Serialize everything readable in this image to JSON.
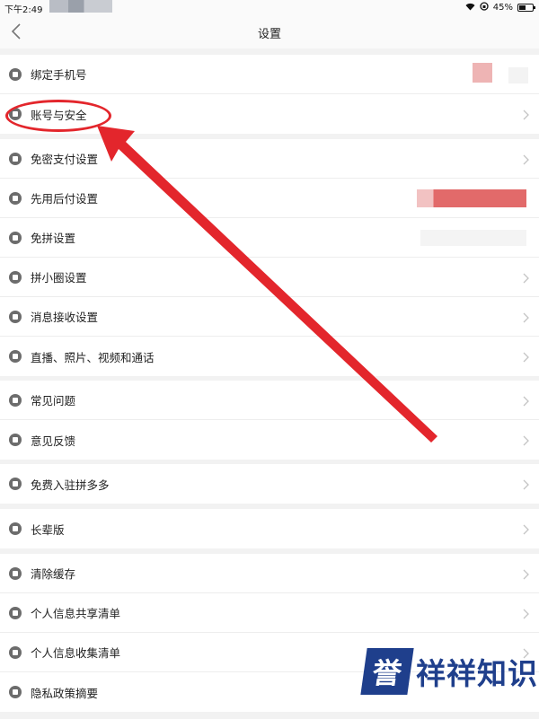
{
  "status": {
    "time": "下午2:49",
    "battery": "45%"
  },
  "nav": {
    "title": "设置"
  },
  "groups": [
    {
      "items": [
        {
          "label": "绑定手机号",
          "icon": "phone-icon"
        },
        {
          "label": "账号与安全",
          "icon": "shield-icon"
        }
      ]
    },
    {
      "items": [
        {
          "label": "免密支付设置",
          "icon": "key-icon"
        },
        {
          "label": "先用后付设置",
          "icon": "gear-icon"
        },
        {
          "label": "免拼设置",
          "icon": "copy-icon"
        },
        {
          "label": "拼小圈设置",
          "icon": "lock-icon"
        },
        {
          "label": "消息接收设置",
          "icon": "mail-icon"
        },
        {
          "label": "直播、照片、视频和通话",
          "icon": "video-icon"
        }
      ]
    },
    {
      "items": [
        {
          "label": "常见问题",
          "icon": "question-icon"
        },
        {
          "label": "意见反馈",
          "icon": "edit-icon"
        }
      ]
    },
    {
      "items": [
        {
          "label": "免费入驻拼多多",
          "icon": "store-icon"
        }
      ]
    },
    {
      "items": [
        {
          "label": "长辈版",
          "icon": "elder-icon"
        }
      ]
    },
    {
      "items": [
        {
          "label": "清除缓存",
          "icon": "clean-icon"
        },
        {
          "label": "个人信息共享清单",
          "icon": "share-icon"
        },
        {
          "label": "个人信息收集清单",
          "icon": "list-icon"
        },
        {
          "label": "隐私政策摘要",
          "icon": "privacy-lock-icon"
        }
      ]
    }
  ],
  "watermark": {
    "box": "誉",
    "text": "祥祥知识"
  },
  "colors": {
    "accent": "#e3262c",
    "watermark": "#1f3f8c"
  }
}
